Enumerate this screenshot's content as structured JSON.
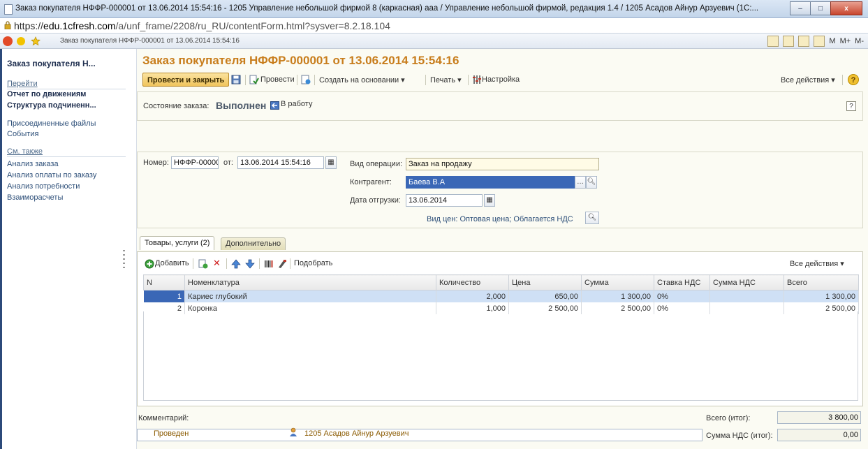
{
  "window": {
    "title": "Заказ покупателя НФФР-000001 от 13.06.2014 15:54:16 - 1205 Управление небольшой фирмой 8 (каркасная) ааа / Управление небольшой фирмой, редакция 1.4 / 1205 Асадов Айнур Арзуевич (1С:...",
    "minimize": "–",
    "maximize": "□",
    "close": "x"
  },
  "address": {
    "scheme": "https://",
    "domain": "edu.1cfresh.com",
    "path": "/a/unf_frame/2208/ru_RU/contentForm.html?sysver=8.2.18.104"
  },
  "browser_tab": {
    "title": "Заказ покупателя НФФР-000001 от 13.06.2014 15:54:16",
    "right_labels": [
      "M",
      "M+",
      "M-"
    ]
  },
  "nav": {
    "document": "Заказ покупателя Н...",
    "go_section": "Перейти",
    "go_items": [
      "Отчет по движениям",
      "Структура подчиненн..."
    ],
    "plain_items": [
      "Присоединенные файлы",
      "События"
    ],
    "see_also_section": "См. также",
    "see_also_items": [
      "Анализ заказа",
      "Анализ оплаты по заказу",
      "Анализ потребности",
      "Взаиморасчеты"
    ]
  },
  "form": {
    "title": "Заказ покупателя НФФР-000001 от 13.06.2014 15:54:16",
    "toolbar": {
      "post_close": "Провести и закрыть",
      "post": "Провести",
      "create_based": "Создать на основании",
      "print": "Печать",
      "settings": "Настройка",
      "all_actions": "Все действия"
    },
    "status": {
      "label": "Состояние заказа:",
      "value": "Выполнен",
      "to_work": "В работу"
    },
    "header": {
      "number_label": "Номер:",
      "number": "НФФР-000001",
      "date_label": "от:",
      "date": "13.06.2014 15:54:16",
      "op_label": "Вид операции:",
      "op": "Заказ на продажу",
      "counterparty_label": "Контрагент:",
      "counterparty": "Баева В.А",
      "ship_label": "Дата отгрузки:",
      "ship_date": "13.06.2014",
      "prices": "Вид цен: Оптовая цена; Облагается НДС"
    },
    "tabs": [
      "Товары, услуги (2)",
      "Дополнительно"
    ],
    "table_toolbar": {
      "add": "Добавить",
      "pick": "Подобрать",
      "all_actions": "Все действия"
    },
    "table": {
      "columns": [
        "N",
        "Номенклатура",
        "Количество",
        "Цена",
        "Сумма",
        "Ставка НДС",
        "Сумма НДС",
        "Всего"
      ],
      "rows": [
        [
          "1",
          "Кариес глубокий",
          "2,000",
          "650,00",
          "1 300,00",
          "0%",
          "",
          "1 300,00"
        ],
        [
          "2",
          "Коронка",
          "1,000",
          "2 500,00",
          "2 500,00",
          "0%",
          "",
          "2 500,00"
        ]
      ]
    },
    "footer": {
      "comment_label": "Комментарий:",
      "total_label": "Всего (итог):",
      "total": "3 800,00",
      "vat_label": "Сумма НДС (итог):",
      "vat": "0,00",
      "posted": "Проведен",
      "author": "1205 Асадов Айнур Арзуевич"
    }
  }
}
